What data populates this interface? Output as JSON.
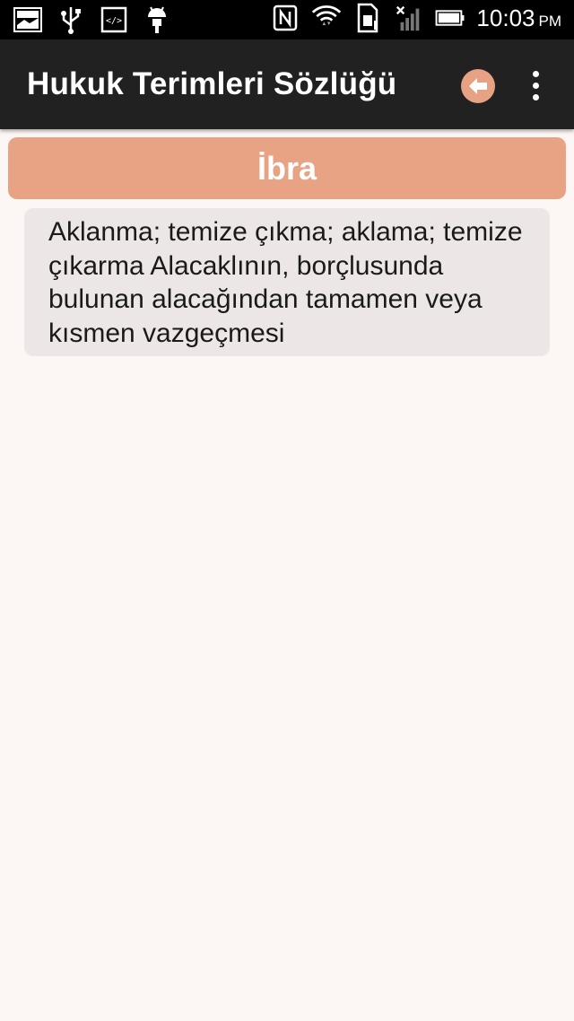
{
  "statusbar": {
    "time": "10:03",
    "ampm": "PM"
  },
  "appbar": {
    "title": "Hukuk Terimleri Sözlüğü",
    "back_icon": "arrow-left-icon",
    "menu_icon": "more-vert-icon"
  },
  "term": {
    "title": "İbra",
    "definition": "Aklanma; temize çıkma; aklama; temize çıkarma Alacaklının, borçlusunda bulunan alacağından tamamen veya kısmen vazgeçmesi"
  },
  "colors": {
    "appbar": "#212121",
    "accent": "#e8a385",
    "card": "#ece7e6",
    "background": "#fcf6f4"
  }
}
